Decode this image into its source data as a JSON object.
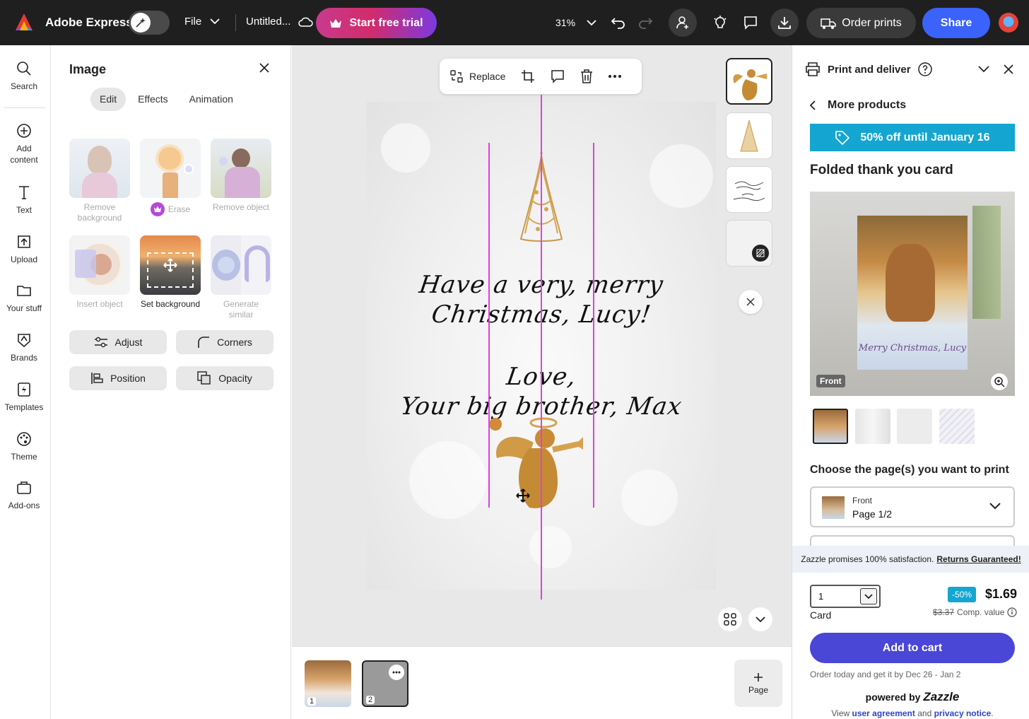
{
  "topbar": {
    "app_name": "Adobe Express",
    "file_label": "File",
    "doc_title": "Untitled...",
    "trial_label": "Start free trial",
    "zoom_value": "31%",
    "order_label": "Order prints",
    "share_label": "Share",
    "colors": {
      "bg": "#1f1f1f",
      "share": "#3b63fb"
    }
  },
  "rail": {
    "items": [
      {
        "label": "Search",
        "icon": "search-icon"
      },
      {
        "label": "Add content",
        "icon": "plus-circle-icon"
      },
      {
        "label": "Text",
        "icon": "text-icon"
      },
      {
        "label": "Upload",
        "icon": "upload-icon"
      },
      {
        "label": "Your stuff",
        "icon": "folder-icon"
      },
      {
        "label": "Brands",
        "icon": "brand-icon"
      },
      {
        "label": "Templates",
        "icon": "templates-icon"
      },
      {
        "label": "Theme",
        "icon": "palette-icon"
      },
      {
        "label": "Add-ons",
        "icon": "addons-icon"
      }
    ]
  },
  "panel": {
    "title": "Image",
    "tabs": [
      "Edit",
      "Effects",
      "Animation"
    ],
    "tools": [
      {
        "label": "Remove background",
        "enabled": false
      },
      {
        "label": "Erase",
        "enabled": false
      },
      {
        "label": "Remove object",
        "enabled": false
      },
      {
        "label": "Insert object",
        "enabled": false
      },
      {
        "label": "Set background",
        "enabled": true
      },
      {
        "label": "Generate similar",
        "enabled": false
      }
    ],
    "buttons": [
      "Adjust",
      "Corners",
      "Position",
      "Opacity"
    ]
  },
  "canvas": {
    "toolbar": {
      "replace_label": "Replace"
    },
    "card_text": {
      "line1": "Have a very, merry",
      "line2": "Christmas, Lucy!",
      "line3": "Love,",
      "line4": "Your big brother, Max"
    },
    "guide_color": "#e040e0"
  },
  "strip": {
    "pages": [
      "1",
      "2"
    ],
    "add_page_label": "Page"
  },
  "print": {
    "header": "Print and deliver",
    "back_label": "More products",
    "promo": "50% off until January 16",
    "product": "Folded thank you card",
    "preview_tag": "Front",
    "preview_card_text": "Merry Christmas, Lucy",
    "choose_label": "Choose the page(s) you want to print",
    "page_select": {
      "label": "Front",
      "value": "Page 1/2"
    },
    "guarantee_text": "Zazzle promises 100% satisfaction.",
    "guarantee_link": "Returns Guaranteed!",
    "quantity": "1",
    "quantity_unit": "Card",
    "discount": "-50%",
    "price": "$1.69",
    "comp_price": "$3.37",
    "comp_label": "Comp. value",
    "cart_label": "Add to cart",
    "delivery": "Order today and get it by Dec 26 - Jan 2",
    "powered_prefix": "powered by",
    "powered_brand": "Zazzle",
    "legal_prefix": "View",
    "legal_link1": "user agreement",
    "legal_mid": "and",
    "legal_link2": "privacy notice",
    "legal_suffix": ".",
    "colors": {
      "promo": "#14a6d0",
      "cart": "#4a46d6"
    }
  }
}
